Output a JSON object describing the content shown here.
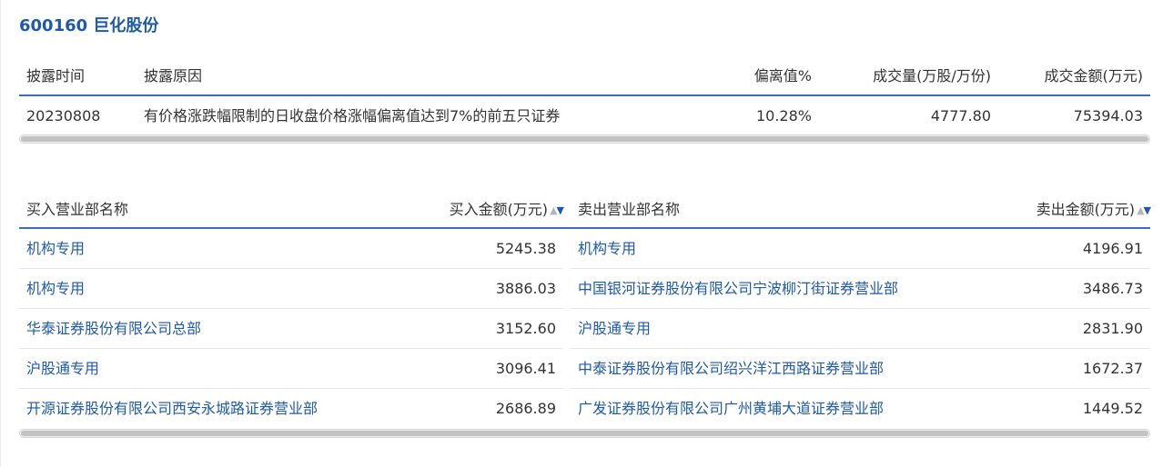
{
  "stock_title": "600160 巨化股份",
  "disclosure": {
    "headers": {
      "time": "披露时间",
      "reason": "披露原因",
      "deviation": "偏离值%",
      "volume": "成交量(万股/万份)",
      "amount": "成交金额(万元)"
    },
    "row": {
      "time": "20230808",
      "reason": "有价格涨跌幅限制的日收盘价格涨幅偏离值达到7%的前五只证券",
      "deviation": "10.28%",
      "volume": "4777.80",
      "amount": "75394.03"
    }
  },
  "trades": {
    "buy_header": {
      "name": "买入营业部名称",
      "amount": "买入金额(万元)"
    },
    "sell_header": {
      "name": "卖出营业部名称",
      "amount": "卖出金额(万元)"
    },
    "sort_icon": {
      "up": "▲",
      "down": "▼"
    },
    "rows": [
      {
        "buy_name": "机构专用",
        "buy_amount": "5245.38",
        "sell_name": "机构专用",
        "sell_amount": "4196.91"
      },
      {
        "buy_name": "机构专用",
        "buy_amount": "3886.03",
        "sell_name": "中国银河证券股份有限公司宁波柳汀街证券营业部",
        "sell_amount": "3486.73"
      },
      {
        "buy_name": "华泰证券股份有限公司总部",
        "buy_amount": "3152.60",
        "sell_name": "沪股通专用",
        "sell_amount": "2831.90"
      },
      {
        "buy_name": "沪股通专用",
        "buy_amount": "3096.41",
        "sell_name": "中泰证券股份有限公司绍兴洋江西路证券营业部",
        "sell_amount": "1672.37"
      },
      {
        "buy_name": "开源证券股份有限公司西安永城路证券营业部",
        "buy_amount": "2686.89",
        "sell_name": "广发证券股份有限公司广州黄埔大道证券营业部",
        "sell_amount": "1449.52"
      }
    ]
  },
  "colors": {
    "accent": "#1e5aa8",
    "header_rule": "#3e6fb5",
    "text": "#333333"
  }
}
